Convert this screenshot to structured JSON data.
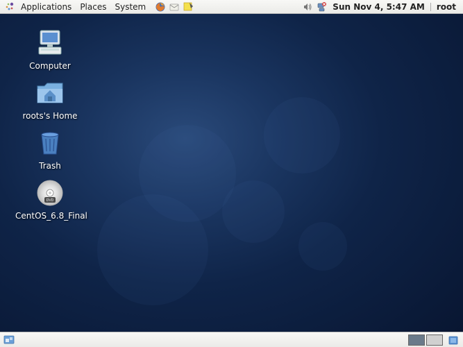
{
  "top_panel": {
    "menus": {
      "applications": "Applications",
      "places": "Places",
      "system": "System"
    },
    "clock": "Sun Nov  4, 5:47 AM",
    "user": "root"
  },
  "desktop_icons": {
    "computer": {
      "label": "Computer"
    },
    "home": {
      "label": "roots's Home"
    },
    "trash": {
      "label": "Trash"
    },
    "disc": {
      "label": "CentOS_6.8_Final"
    }
  }
}
